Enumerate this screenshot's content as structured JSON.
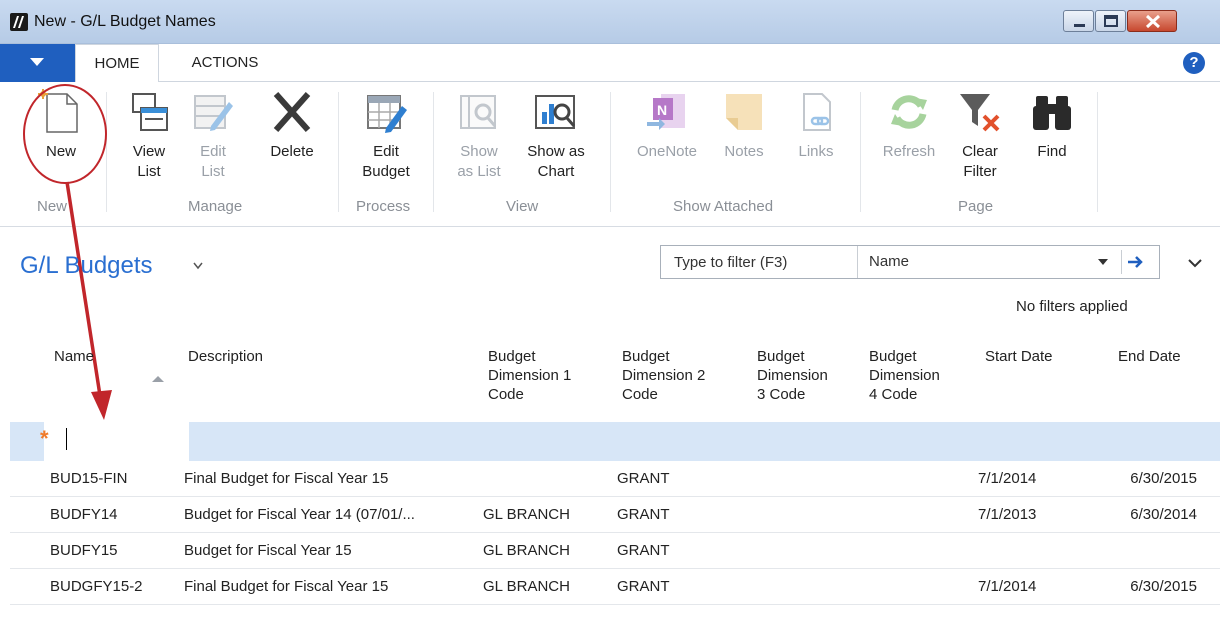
{
  "window": {
    "title": "New - G/L Budget Names"
  },
  "tabs": [
    {
      "label": "HOME"
    },
    {
      "label": "ACTIONS"
    }
  ],
  "ribbon": {
    "groups": [
      {
        "label": "New"
      },
      {
        "label": "Manage"
      },
      {
        "label": "Process"
      },
      {
        "label": "View"
      },
      {
        "label": "Show Attached"
      },
      {
        "label": "Page"
      }
    ],
    "buttons": {
      "new": {
        "line1": "New"
      },
      "view_list": {
        "line1": "View",
        "line2": "List"
      },
      "edit_list": {
        "line1": "Edit",
        "line2": "List"
      },
      "delete": {
        "line1": "Delete"
      },
      "edit_budget": {
        "line1": "Edit",
        "line2": "Budget"
      },
      "show_as_list": {
        "line1": "Show",
        "line2": "as List"
      },
      "show_as_chart": {
        "line1": "Show as",
        "line2": "Chart"
      },
      "onenote": {
        "line1": "OneNote"
      },
      "notes": {
        "line1": "Notes"
      },
      "links": {
        "line1": "Links"
      },
      "refresh": {
        "line1": "Refresh"
      },
      "clear_filter": {
        "line1": "Clear",
        "line2": "Filter"
      },
      "find": {
        "line1": "Find"
      }
    }
  },
  "list": {
    "title": "G/L Budgets",
    "filter": {
      "placeholder": "Type to filter (F3)",
      "field": "Name"
    },
    "filter_status": "No filters applied",
    "columns": [
      {
        "label": "Name"
      },
      {
        "label": "Description"
      },
      {
        "l1": "Budget",
        "l2": "Dimension 1",
        "l3": "Code"
      },
      {
        "l1": "Budget",
        "l2": "Dimension 2",
        "l3": "Code"
      },
      {
        "l1": "Budget",
        "l2": "Dimension",
        "l3": "3 Code"
      },
      {
        "l1": "Budget",
        "l2": "Dimension",
        "l3": "4 Code"
      },
      {
        "label": "Start Date"
      },
      {
        "label": "End Date"
      }
    ],
    "new_row_marker": "*",
    "rows": [
      {
        "name": "BUD15-FIN",
        "description": "Final Budget for Fiscal Year 15",
        "dim1": "",
        "dim2": "GRANT",
        "start": "7/1/2014",
        "end": "6/30/2015"
      },
      {
        "name": "BUDFY14",
        "description": "Budget for Fiscal Year 14 (07/01/...",
        "dim1": "GL BRANCH",
        "dim2": "GRANT",
        "start": "7/1/2013",
        "end": "6/30/2014"
      },
      {
        "name": "BUDFY15",
        "description": "Budget for Fiscal Year 15",
        "dim1": "GL BRANCH",
        "dim2": "GRANT",
        "start": "",
        "end": ""
      },
      {
        "name": "BUDGFY15-2",
        "description": "Final Budget for Fiscal Year 15",
        "dim1": "GL BRANCH",
        "dim2": "GRANT",
        "start": "7/1/2014",
        "end": "6/30/2015"
      }
    ]
  },
  "colors": {
    "accent": "#2a6fd1",
    "brand": "#1f5fbf",
    "highlight": "#c1262b",
    "selected_row": "#d7e6f7"
  }
}
